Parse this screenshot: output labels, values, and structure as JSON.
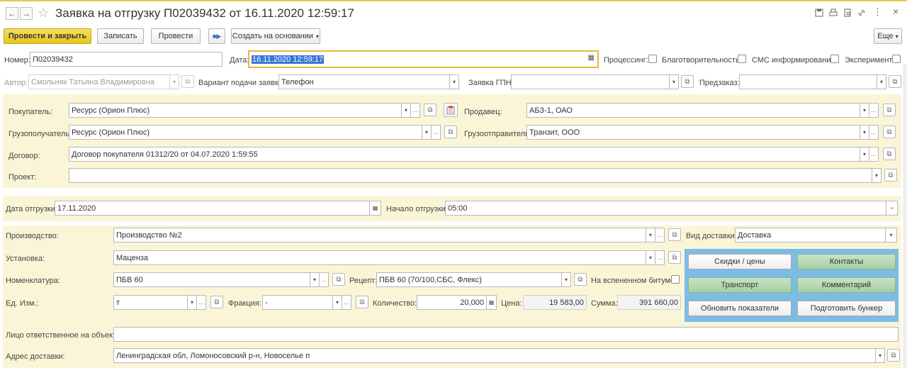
{
  "header": {
    "title": "Заявка на отгрузку П02039432 от 16.11.2020 12:59:17",
    "back": "←",
    "forward": "→",
    "star": "☆",
    "more": "⋮",
    "close": "×"
  },
  "toolbar": {
    "post_close": "Провести и закрыть",
    "save": "Записать",
    "post": "Провести",
    "create_based": "Создать на основании",
    "more": "Еще"
  },
  "fields": {
    "number_label": "Номер:",
    "number_value": "П02039432",
    "date_label": "Дата:",
    "date_value": "16.11.2020 12:59:17",
    "processing_label": "Процессинг:",
    "charity_label": "Благотворительность:",
    "sms_label": "СМС информирование:",
    "experiment_label": "Эксперимент:",
    "author_label": "Автор:",
    "author_value": "Смольняк Татьяна Владимировна",
    "variant_label": "Вариант подачи заявки:",
    "variant_value": "Телефон",
    "gpn_label": "Заявка ГПН:",
    "gpn_value": "",
    "preorder_label": "Предзаказ:",
    "preorder_value": ""
  },
  "parties": {
    "buyer_label": "Покупатель:",
    "buyer_value": "Ресурс (Орион Плюс)",
    "seller_label": "Продавец:",
    "seller_value": "АБЗ-1, ОАО",
    "consignee_label": "Грузополучатель:",
    "consignee_value": "Ресурс (Орион Плюс)",
    "shipper_label": "Грузоотправитель:",
    "shipper_value": "Транзит, ООО",
    "contract_label": "Договор:",
    "contract_value": "Договор покупателя 01312/20 от 04.07.2020 1:59:55",
    "project_label": "Проект:",
    "project_value": ""
  },
  "shipment": {
    "date_label": "Дата отгрузки:",
    "date_value": "17.11.2020",
    "start_label": "Начало отгрузки:",
    "start_value": "05:00"
  },
  "production": {
    "production_label": "Производство:",
    "production_value": "Производство №2",
    "delivery_type_label": "Вид доставки:",
    "delivery_type_value": "Доставка",
    "plant_label": "Установка:",
    "plant_value": "Маценза",
    "nomenclature_label": "Номенклатура:",
    "nomenclature_value": "ПБВ 60",
    "recipe_label": "Рецепт:",
    "recipe_value": "ПБВ 60 (70/100,СБС, Флекс)",
    "foamed_label": "На вспененном битуме:",
    "unit_label": "Ед. Изм.:",
    "unit_value": "т",
    "fraction_label": "Фракция:",
    "fraction_value": "-",
    "qty_label": "Количество:",
    "qty_value": "20,000",
    "price_label": "Цена:",
    "price_value": "19 583,00",
    "sum_label": "Сумма:",
    "sum_value": "391 660,00",
    "responsible_label": "Лицо ответственное на объекте:",
    "responsible_value": "",
    "address_label": "Адрес доставки:",
    "address_value": "Ленинградская обл, Ломоносовский р-н, Новоселье п"
  },
  "actions": {
    "discounts": "Скидки / цены",
    "contacts": "Контакты",
    "transport": "Транспорт",
    "comment": "Комментарий",
    "refresh": "Обновить показатели",
    "prepare_bunker": "Подготовить бункер"
  },
  "glyphs": {
    "dropdown": "▾",
    "ellipsis": "...",
    "open": "⧉",
    "calendar": "▦",
    "spin": "÷"
  }
}
